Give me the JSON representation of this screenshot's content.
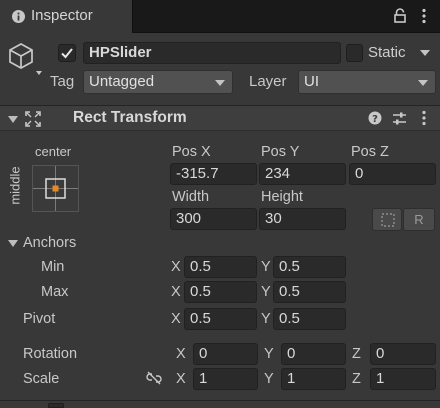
{
  "tab": {
    "title": "Inspector"
  },
  "gameobject": {
    "name": "HPSlider",
    "active": true,
    "static_label": "Static",
    "static_checked": false,
    "tag_label": "Tag",
    "tag_value": "Untagged",
    "layer_label": "Layer",
    "layer_value": "UI"
  },
  "rect_transform": {
    "title": "Rect Transform",
    "anchor_preset": {
      "horizontal": "center",
      "vertical": "middle"
    },
    "pos_x_label": "Pos X",
    "pos_x": "-315.7",
    "pos_y_label": "Pos Y",
    "pos_y": "234",
    "pos_z_label": "Pos Z",
    "pos_z": "0",
    "width_label": "Width",
    "width": "300",
    "height_label": "Height",
    "height": "30",
    "raw_button_label": "R",
    "anchors": {
      "label": "Anchors",
      "min_label": "Min",
      "min_x": "0.5",
      "min_y": "0.5",
      "max_label": "Max",
      "max_x": "0.5",
      "max_y": "0.5"
    },
    "pivot_label": "Pivot",
    "pivot_x": "0.5",
    "pivot_y": "0.5",
    "rotation_label": "Rotation",
    "rot_x": "0",
    "rot_y": "0",
    "rot_z": "0",
    "scale_label": "Scale",
    "scale_x": "1",
    "scale_y": "1",
    "scale_z": "1",
    "axis_x": "X",
    "axis_y": "Y",
    "axis_z": "Z"
  }
}
